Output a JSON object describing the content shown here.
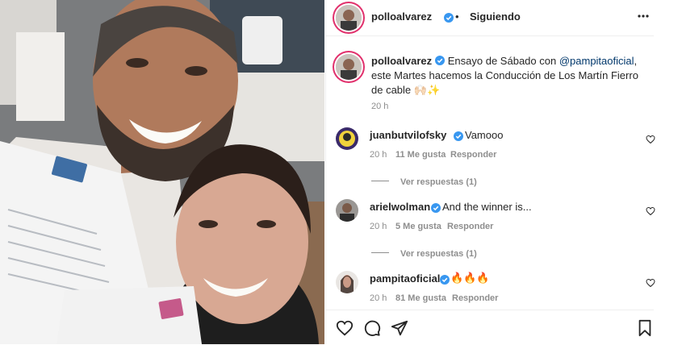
{
  "post": {
    "author": "polloalvarez",
    "separator": "•",
    "follow_status": "Siguiendo",
    "more_icon": "more-horizontal-icon"
  },
  "caption": {
    "author": "polloalvarez",
    "text_before_mention": "Ensayo de Sábado con",
    "mention": "@pampitaoficial",
    "text_after_mention": ", este Martes hacemos la Conducción de Los Martín Fierro de cable",
    "emoji": "🙌🏻✨",
    "time": "20 h"
  },
  "comments": [
    {
      "username": "juanbutvilofsky",
      "text": "Vamooo",
      "time": "20 h",
      "likes": "11 Me gusta",
      "reply_label": "Responder",
      "view_replies": "Ver respuestas (1)"
    },
    {
      "username": "arielwolman",
      "text": "And the winner is...",
      "time": "20 h",
      "likes": "5 Me gusta",
      "reply_label": "Responder",
      "view_replies": "Ver respuestas (1)"
    },
    {
      "username": "pampitaoficial",
      "text": "🔥🔥🔥",
      "time": "20 h",
      "likes": "81 Me gusta",
      "reply_label": "Responder"
    }
  ],
  "icons": {
    "like": "heart-icon",
    "comment": "comment-icon",
    "share": "send-icon",
    "save": "bookmark-icon"
  },
  "colors": {
    "verified": "#3897f0",
    "text": "#262626",
    "muted": "#8e8e8e",
    "story_ring": "#e1306c"
  }
}
